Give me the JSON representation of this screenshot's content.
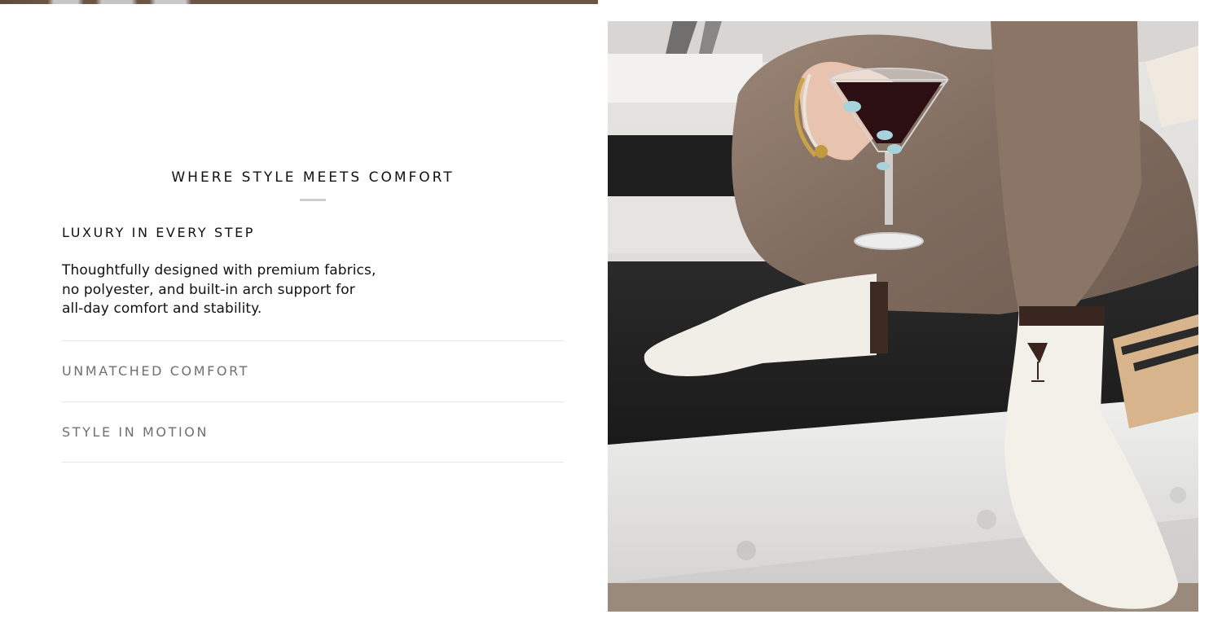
{
  "section": {
    "title": "WHERE STYLE MEETS COMFORT"
  },
  "accordion": {
    "items": [
      {
        "label": "LUXURY IN EVERY STEP",
        "state": "open",
        "body": "Thoughtfully designed with premium fabrics, no polyester, and built-in arch support for all-day comfort and stability."
      },
      {
        "label": "UNMATCHED COMFORT",
        "state": "closed"
      },
      {
        "label": "STYLE IN MOTION",
        "state": "closed"
      }
    ]
  },
  "colors": {
    "text": "#111111",
    "muted": "#707070",
    "divider": "#e8e8e8",
    "accent_rule": "#cfcfcf"
  },
  "media": {
    "photo_icon": "product-lifestyle-photo"
  }
}
